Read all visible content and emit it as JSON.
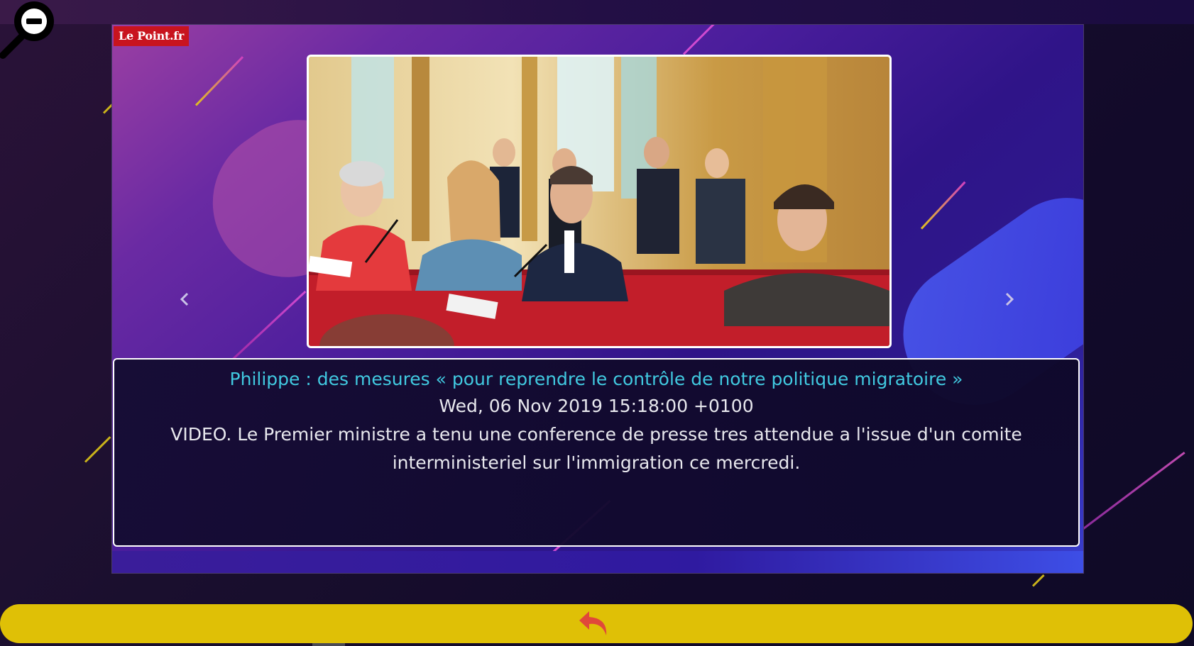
{
  "brand": {
    "logo_text": "Le Point.fr",
    "logo_color": "#c8141e"
  },
  "toolbar": {
    "zoom_out_icon": "zoom-out-magnifier-icon"
  },
  "slider": {
    "image_description": "Press conference photo",
    "prev_icon": "chevron-left-icon",
    "next_icon": "chevron-right-icon"
  },
  "article": {
    "title": "Philippe : des mesures « pour reprendre le contrôle de notre politique migratoire »",
    "date": "Wed, 06 Nov 2019 15:18:00 +0100",
    "description": "VIDEO. Le Premier ministre a tenu une conference de presse tres attendue a l'issue d'un comite interministeriel sur l'immigration ce mercredi."
  },
  "footer": {
    "back_icon": "undo-arrow-icon",
    "back_bar_color": "#dfc006",
    "back_icon_color": "#e0483a"
  },
  "colors": {
    "title": "#41c9e0",
    "text": "#e8e8ee"
  }
}
